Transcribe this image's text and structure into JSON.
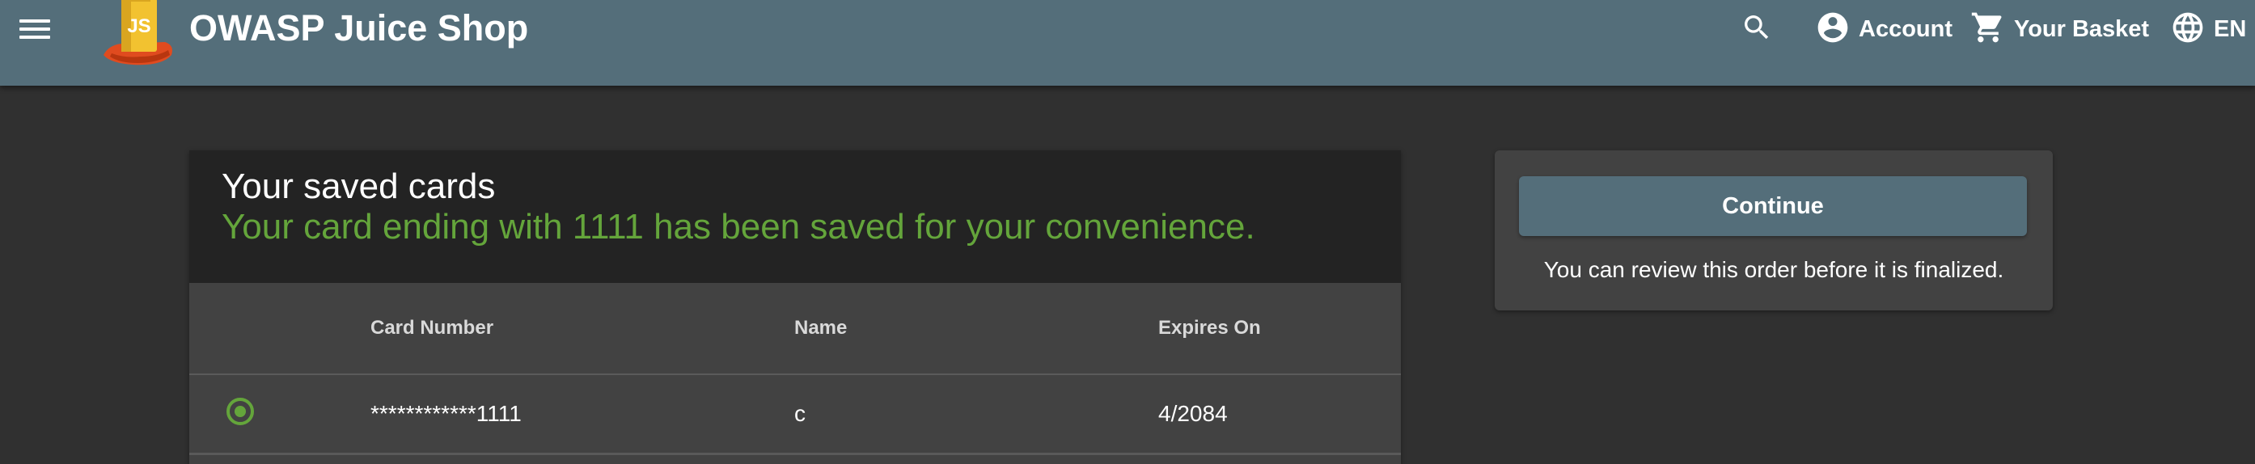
{
  "header": {
    "app_title": "OWASP Juice Shop",
    "logo_label": "JS",
    "menu_icon": "hamburger-menu-icon",
    "search_icon": "search-icon",
    "account_label": "Account",
    "basket_label": "Your Basket",
    "language_label": "EN",
    "toolbar_color": "#546e7a"
  },
  "cards": {
    "title": "Your saved cards",
    "message": "Your card ending with 1111 has been saved for your convenience.",
    "columns": [
      "Card Number",
      "Name",
      "Expires On"
    ],
    "rows": [
      {
        "selected": true,
        "card_number": "************1111",
        "name": "c",
        "expires": "4/2084"
      }
    ],
    "accent_color": "#64a53b"
  },
  "checkout": {
    "continue_label": "Continue",
    "note": "You can review this order before it is finalized."
  }
}
